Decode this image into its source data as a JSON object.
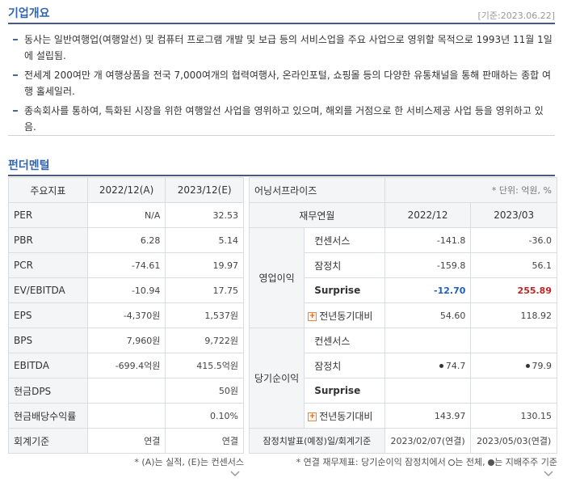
{
  "overview": {
    "title": "기업개요",
    "date": "[기준:2023.06.22]",
    "items": [
      "동사는 일반여행업(여행알선) 및 컴퓨터 프로그램 개발 및 보급 등의 서비스업을 주요 사업으로 영위할 목적으로 1993년 11월 1일에 설립됨.",
      "전세계 200여만 개 여행상품을 전국 7,000여개의 협력여행사, 온라인포털, 쇼핑몰 등의 다양한 유통채널을 통해 판매하는 종합 여행 홀세일러.",
      "종속회사를 통하여, 특화된 시장을 위한 여행알선 사업을 영위하고 있으며, 해외를 거점으로 한 서비스제공 사업 등을 영위하고 있음."
    ]
  },
  "fundamental": {
    "title": "펀더멘털",
    "headers": [
      "주요지표",
      "2022/12(A)",
      "2023/12(E)"
    ],
    "rows": [
      [
        "PER",
        "N/A",
        "32.53"
      ],
      [
        "PBR",
        "6.28",
        "5.14"
      ],
      [
        "PCR",
        "-74.61",
        "19.97"
      ],
      [
        "EV/EBITDA",
        "-10.94",
        "17.75"
      ],
      [
        "EPS",
        "-4,370원",
        "1,537원"
      ],
      [
        "BPS",
        "7,960원",
        "9,722원"
      ],
      [
        "EBITDA",
        "-699.4억원",
        "415.5억원"
      ],
      [
        "현금DPS",
        "",
        "50원"
      ],
      [
        "현금배당수익률",
        "",
        "0.10%"
      ],
      [
        "회계기준",
        "연결",
        "연결"
      ]
    ],
    "note": "* (A)는 실적, (E)는 컨센서스"
  },
  "earnings": {
    "brand": "어닝서프라이즈",
    "unit": "* 단위: 억원, %",
    "headers": [
      "재무연월",
      "2022/12",
      "2023/03"
    ],
    "op_group": "영업이익",
    "op_rows": [
      {
        "label": "컨센서스",
        "a": "-141.8",
        "b": "-36.0"
      },
      {
        "label": "잠정치",
        "a": "-159.8",
        "b": "56.1"
      },
      {
        "label": "Surprise",
        "a": "-12.70",
        "b": "255.89"
      },
      {
        "label": "전년동기대비",
        "a": "54.60",
        "b": "118.92"
      }
    ],
    "net_group": "당기순이익",
    "net_rows": [
      {
        "label": "컨센서스",
        "a": "",
        "b": ""
      },
      {
        "label": "잠정치",
        "a": "74.7",
        "b": "79.9"
      },
      {
        "label": "Surprise",
        "a": "",
        "b": ""
      },
      {
        "label": "전년동기대비",
        "a": "143.97",
        "b": "130.15"
      }
    ],
    "footer_label": "잠정치발표(예정)일/회계기준",
    "footer_a": "2023/02/07(연결)",
    "footer_b": "2023/05/03(연결)",
    "note_prefix": "* 연결 재무제표: 당기순이익 잠정치에서",
    "note_empty": "는 전체,",
    "note_full": "는 지배주주 기준"
  }
}
